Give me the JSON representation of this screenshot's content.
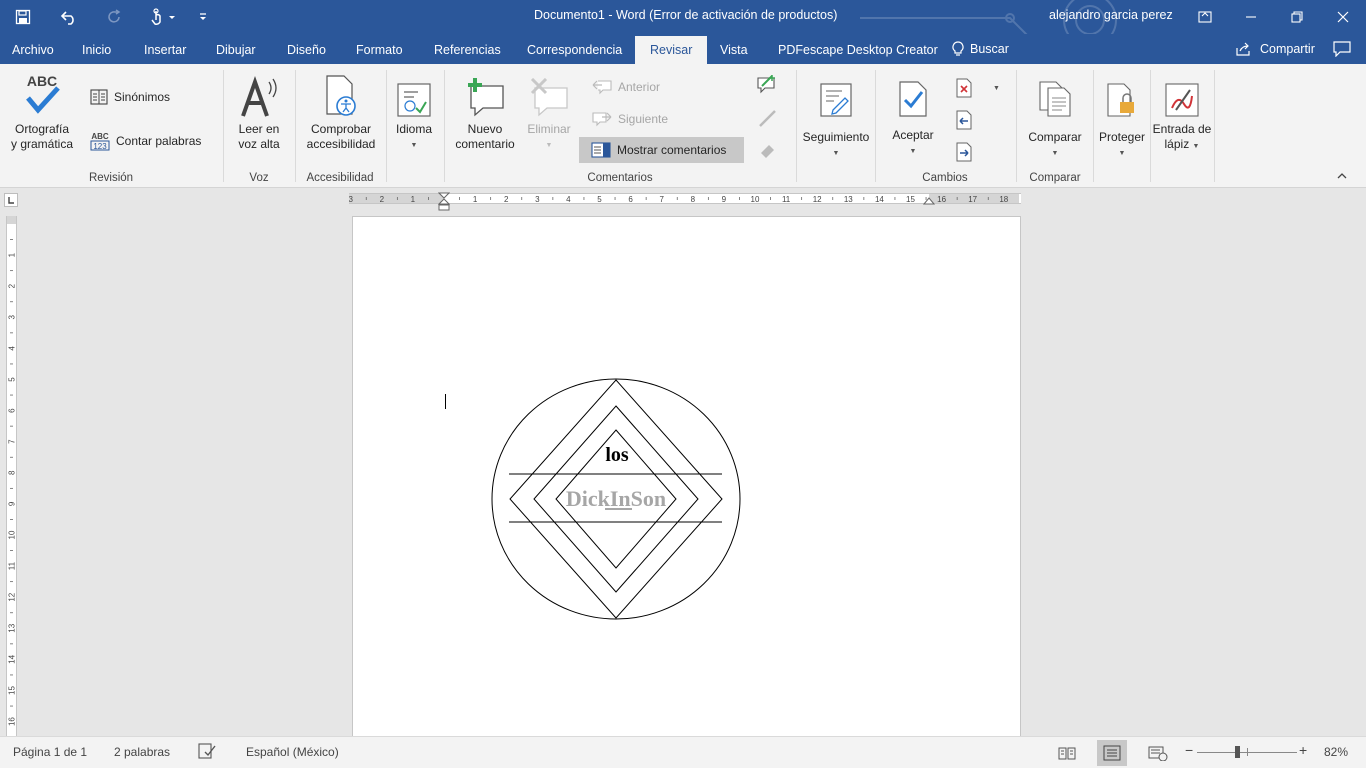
{
  "window": {
    "title": "Documento1  -  Word (Error de activación de productos)",
    "user": "alejandro garcia perez"
  },
  "colors": {
    "accent": "#2b579a",
    "ribbon_bg": "#f3f3f3",
    "workspace": "#e6e6e6"
  },
  "qat": {
    "icons": [
      "save-icon",
      "undo-icon",
      "redo-icon",
      "touch-mode-icon",
      "customize-qat-icon"
    ]
  },
  "tabs": [
    {
      "id": "archivo",
      "label": "Archivo"
    },
    {
      "id": "inicio",
      "label": "Inicio"
    },
    {
      "id": "insertar",
      "label": "Insertar"
    },
    {
      "id": "dibujar",
      "label": "Dibujar"
    },
    {
      "id": "diseno",
      "label": "Diseño"
    },
    {
      "id": "formato",
      "label": "Formato"
    },
    {
      "id": "referencias",
      "label": "Referencias"
    },
    {
      "id": "correspondencia",
      "label": "Correspondencia"
    },
    {
      "id": "revisar",
      "label": "Revisar",
      "active": true
    },
    {
      "id": "vista",
      "label": "Vista"
    },
    {
      "id": "pdfescape",
      "label": "PDFescape Desktop Creator"
    }
  ],
  "search": {
    "label": "Buscar"
  },
  "share": {
    "label": "Compartir"
  },
  "ribbon": {
    "revision": {
      "label": "Revisión",
      "spelling_icon_text": "ABC",
      "spelling_line1": "Ortografía",
      "spelling_line2": "y gramática",
      "synonyms": "Sinónimos",
      "wordcount_icon_top": "ABC",
      "wordcount_icon_bottom": "123",
      "word_count": "Contar palabras"
    },
    "voz": {
      "label": "Voz",
      "read_line1": "Leer en",
      "read_line2": "voz alta"
    },
    "accesibilidad": {
      "label": "Accesibilidad",
      "check_line1": "Comprobar",
      "check_line2": "accesibilidad"
    },
    "idioma": {
      "label": "Idioma"
    },
    "comentarios": {
      "label": "Comentarios",
      "new_line1": "Nuevo",
      "new_line2": "comentario",
      "delete": "Eliminar",
      "previous": "Anterior",
      "next": "Siguiente",
      "show_comments": "Mostrar comentarios"
    },
    "seguimiento": {
      "label": "Seguimiento"
    },
    "cambios": {
      "label": "Cambios",
      "accept": "Aceptar"
    },
    "comparar": {
      "label": "Comparar",
      "compare": "Comparar"
    },
    "proteger": {
      "label": "Proteger"
    },
    "lapiz": {
      "line1": "Entrada de",
      "line2": "lápiz"
    }
  },
  "ruler": {
    "h_labels": [
      "3",
      "2",
      "1",
      "1",
      "2",
      "3",
      "4",
      "5",
      "6",
      "7",
      "8",
      "9",
      "10",
      "11",
      "12",
      "13",
      "14",
      "15",
      "16",
      "17",
      "18"
    ],
    "v_labels": [
      "1",
      "2",
      "3",
      "4",
      "5",
      "6",
      "7",
      "8",
      "9",
      "10",
      "11",
      "12",
      "13",
      "14",
      "15",
      "16"
    ]
  },
  "document": {
    "shape_top_text": "los",
    "logo_text": "DickInSon"
  },
  "status": {
    "page": "Página 1 de 1",
    "words": "2 palabras",
    "language": "Español (México)",
    "zoom_minus": "−",
    "zoom_plus": "+",
    "zoom": "82%"
  }
}
